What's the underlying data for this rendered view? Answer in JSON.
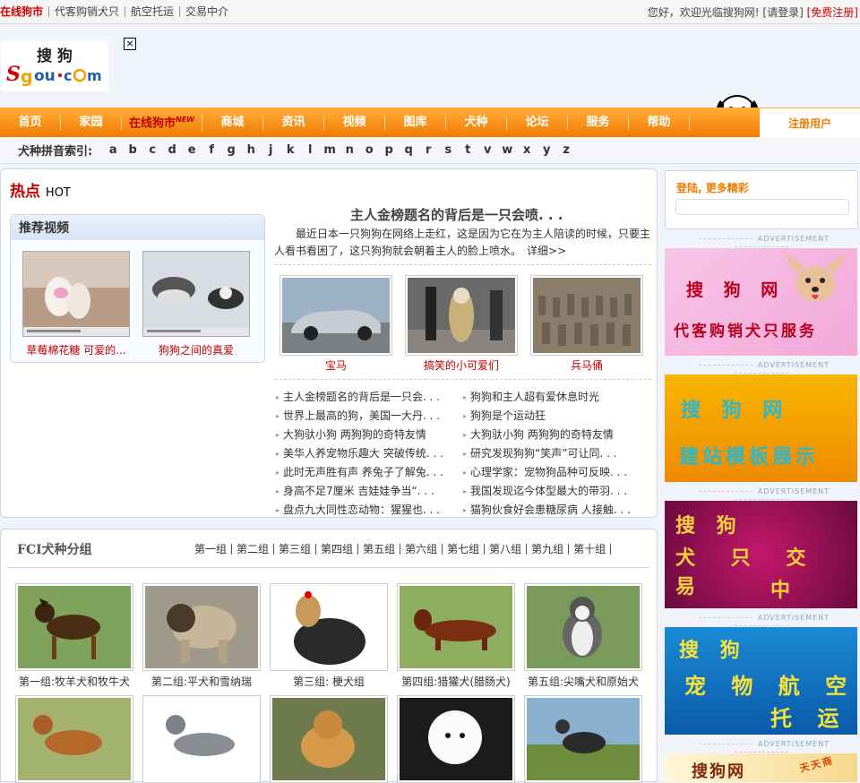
{
  "topbar": {
    "links": [
      "在线狗市",
      "代客购销犬只",
      "航空托运",
      "交易中介"
    ],
    "welcome": "您好，欢迎光临搜狗网!",
    "login": "[请登录]",
    "register": "[免费注册]"
  },
  "logo": {
    "cn": "搜 狗",
    "en": "Sgou·com"
  },
  "nav": {
    "items": [
      "首页",
      "家园",
      "在线狗市",
      "商城",
      "资讯",
      "视频",
      "图库",
      "犬种",
      "论坛",
      "服务",
      "帮助"
    ],
    "new_badge": "NEW",
    "register_user": "注册用户"
  },
  "pinyin": {
    "label": "犬种拼音索引:",
    "letters": [
      "a",
      "b",
      "c",
      "d",
      "e",
      "f",
      "g",
      "h",
      "j",
      "k",
      "l",
      "m",
      "n",
      "o",
      "p",
      "q",
      "r",
      "s",
      "t",
      "v",
      "w",
      "x",
      "y",
      "z"
    ]
  },
  "hot": {
    "title": "热点",
    "title_en": "HOT",
    "video_title": "推荐视频",
    "videos": [
      {
        "caption": "草莓棉花糖 可爱的..."
      },
      {
        "caption": "狗狗之间的真爱"
      }
    ],
    "headline": "主人金榜题名的背后是一只会喷. . .",
    "summary": "最近日本一只狗狗在网络上走红，这是因为它在为主人陪读的时候，只要主人看书看困了，这只狗狗就会朝着主人的脸上喷水。",
    "more": "详细>>",
    "pictures": [
      {
        "caption": "宝马"
      },
      {
        "caption": "搞笑的小可爱们"
      },
      {
        "caption": "兵马俑"
      }
    ],
    "news_left": [
      "主人金榜题名的背后是一只会. . .",
      "世界上最高的狗，美国一大丹. . .",
      "大狗驮小狗 两狗狗的奇特友情",
      "美华人养宠物乐趣大 突破传统. . .",
      "此时无声胜有声 养兔子了解兔. . .",
      "身高不足7厘米 吉娃娃争当“. . .",
      "盘点九大同性恋动物：猩猩也. . ."
    ],
    "news_right": [
      "狗狗和主人超有爱休息时光",
      "狗狗是个运动狂",
      "大狗驮小狗 两狗狗的奇特友情",
      "研究发现狗狗“笑声”可让同. . .",
      "心理学家：宠物狗品种可反映. . .",
      "我国发现迄今体型最大的带羽. . .",
      "猫狗伙食好会患糖尿病 人接触. . ."
    ]
  },
  "fci": {
    "title": "FCI犬种分组",
    "groups": [
      "第一组",
      "第二组",
      "第三组",
      "第四组",
      "第五组",
      "第六组",
      "第七组",
      "第八组",
      "第九组",
      "第十组"
    ],
    "dogs_row1": [
      {
        "caption": "第一组:牧羊犬和牧牛犬"
      },
      {
        "caption": "第二组:平犬和雪纳瑞"
      },
      {
        "caption": "第三组: 梗犬组"
      },
      {
        "caption": "第四组:猎獾犬(腊肠犬)"
      },
      {
        "caption": "第五组:尖嘴犬和原始犬"
      }
    ]
  },
  "sidebar": {
    "login_text": "登陆, 更多精彩",
    "ad_label": "ADVERTISEMENT",
    "ads": [
      {
        "line1": "搜 狗 网",
        "line2": "代客购销犬只服务"
      },
      {
        "line1": "搜 狗 网",
        "line2": "建站模板展示"
      },
      {
        "line1": "搜 狗",
        "line2": "犬 只 交 易",
        "line3": "中 介"
      },
      {
        "line1": "搜 狗",
        "line2": "宠 物 航 空",
        "line3": "托 运"
      },
      {
        "line1": "搜狗网",
        "line2": "天天商"
      }
    ]
  },
  "colors": {
    "brand_red": "#c00000",
    "nav_orange": "#f07b00",
    "accent_blue": "#c8d6e8"
  }
}
